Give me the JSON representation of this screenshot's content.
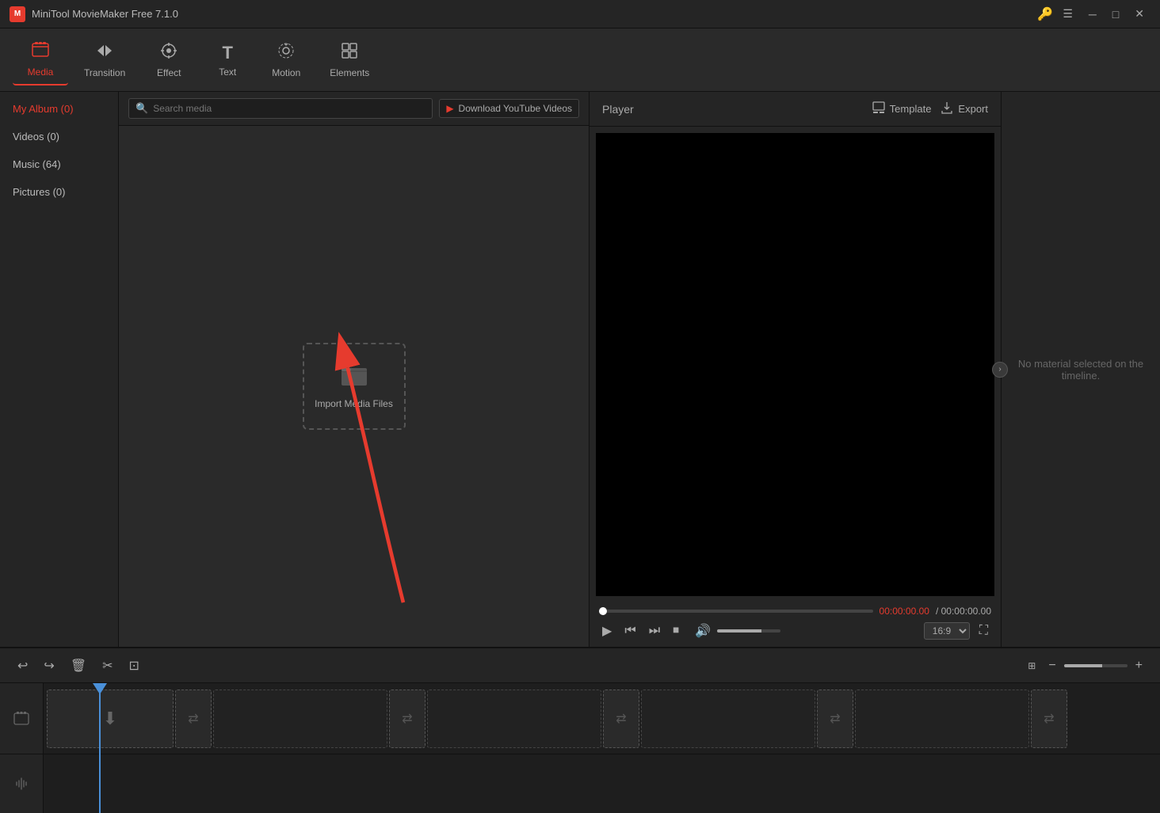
{
  "app": {
    "title": "MiniTool MovieMaker Free 7.1.0",
    "logo_text": "M"
  },
  "toolbar": {
    "items": [
      {
        "id": "media",
        "label": "Media",
        "icon": "🎬",
        "active": true
      },
      {
        "id": "transition",
        "label": "Transition",
        "icon": "⇄"
      },
      {
        "id": "effect",
        "label": "Effect",
        "icon": "✦"
      },
      {
        "id": "text",
        "label": "Text",
        "icon": "T"
      },
      {
        "id": "motion",
        "label": "Motion",
        "icon": "◎"
      },
      {
        "id": "elements",
        "label": "Elements",
        "icon": "⊞"
      }
    ]
  },
  "sidebar": {
    "items": [
      {
        "id": "my-album",
        "label": "My Album (0)",
        "active": true
      },
      {
        "id": "videos",
        "label": "Videos (0)"
      },
      {
        "id": "music",
        "label": "Music (64)"
      },
      {
        "id": "pictures",
        "label": "Pictures (0)"
      }
    ]
  },
  "media": {
    "search_placeholder": "Search media",
    "download_youtube": "Download YouTube Videos",
    "import_label": "Import Media Files"
  },
  "player": {
    "title": "Player",
    "template_label": "Template",
    "export_label": "Export",
    "time_current": "00:00:00.00",
    "time_total": "/ 00:00:00.00",
    "no_material": "No material selected on the timeline.",
    "aspect_ratio": "16:9"
  },
  "timeline": {
    "zoom_level": 60
  }
}
